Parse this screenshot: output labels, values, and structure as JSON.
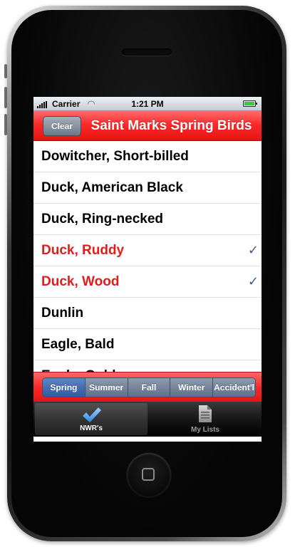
{
  "status_bar": {
    "carrier": "Carrier",
    "time": "1:21 PM"
  },
  "nav_bar": {
    "clear_label": "Clear",
    "title": "Saint Marks Spring Birds",
    "color": "#f52626"
  },
  "birds": [
    {
      "name": "Dowitcher, Short-billed",
      "checked": false
    },
    {
      "name": "Duck, American Black",
      "checked": false
    },
    {
      "name": "Duck, Ring-necked",
      "checked": false
    },
    {
      "name": "Duck, Ruddy",
      "checked": true
    },
    {
      "name": "Duck, Wood",
      "checked": true
    },
    {
      "name": "Dunlin",
      "checked": false
    },
    {
      "name": "Eagle, Bald",
      "checked": false
    },
    {
      "name": "Eagle, Golden",
      "checked": false
    }
  ],
  "check_mark": "✓",
  "checked_color": "#e31b1b",
  "season_filter": {
    "items": [
      "Spring",
      "Summer",
      "Fall",
      "Winter",
      "Accident'l"
    ],
    "selected": "Spring"
  },
  "tab_bar": {
    "tabs": [
      {
        "label": "NWR's",
        "icon": "checkmark-icon",
        "active": true
      },
      {
        "label": "My Lists",
        "icon": "document-icon",
        "active": false
      }
    ]
  }
}
